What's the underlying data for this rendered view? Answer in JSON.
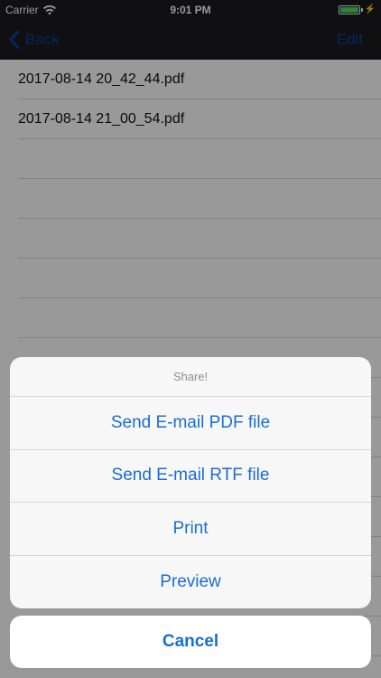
{
  "status_bar": {
    "carrier": "Carrier",
    "time": "9:01 PM",
    "battery_level": 1.0,
    "battery_color": "#4cd964"
  },
  "nav": {
    "back_label": "Back",
    "edit_label": "Edit",
    "tint": "#0a3ea0"
  },
  "files": [
    "2017-08-14 20_42_44.pdf",
    "2017-08-14 21_00_54.pdf",
    "",
    "",
    "",
    "",
    "",
    "",
    "",
    "",
    "",
    "",
    "",
    "",
    ""
  ],
  "action_sheet": {
    "title": "Share!",
    "buttons": [
      "Send E-mail PDF file",
      "Send E-mail RTF file",
      "Print",
      "Preview"
    ],
    "cancel_label": "Cancel",
    "button_color": "#1a6dd6"
  },
  "icons": {
    "back": "chevron-left-icon",
    "wifi": "wifi-icon",
    "battery": "battery-icon",
    "charging": "bolt-icon"
  }
}
